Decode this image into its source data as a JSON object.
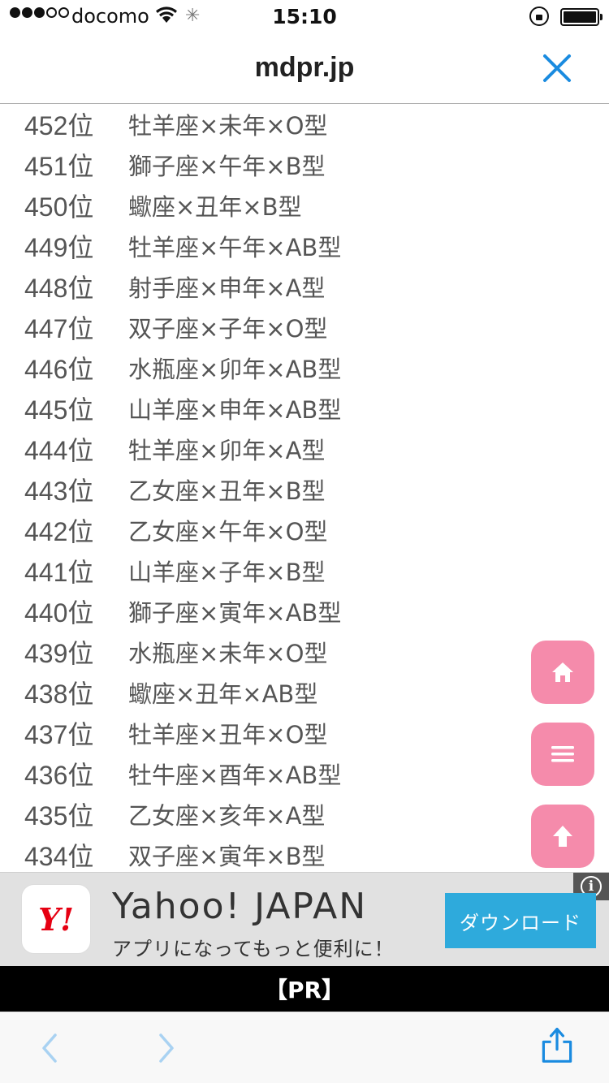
{
  "status_bar": {
    "carrier": "docomo",
    "time": "15:10"
  },
  "header": {
    "title": "mdpr.jp"
  },
  "ranking": [
    {
      "rank": "452位",
      "combo": "牡羊座×未年×O型"
    },
    {
      "rank": "451位",
      "combo": "獅子座×午年×B型"
    },
    {
      "rank": "450位",
      "combo": "蠍座×丑年×B型"
    },
    {
      "rank": "449位",
      "combo": "牡羊座×午年×AB型"
    },
    {
      "rank": "448位",
      "combo": "射手座×申年×A型"
    },
    {
      "rank": "447位",
      "combo": "双子座×子年×O型"
    },
    {
      "rank": "446位",
      "combo": "水瓶座×卯年×AB型"
    },
    {
      "rank": "445位",
      "combo": "山羊座×申年×AB型"
    },
    {
      "rank": "444位",
      "combo": "牡羊座×卯年×A型"
    },
    {
      "rank": "443位",
      "combo": "乙女座×丑年×B型"
    },
    {
      "rank": "442位",
      "combo": "乙女座×午年×O型"
    },
    {
      "rank": "441位",
      "combo": "山羊座×子年×B型"
    },
    {
      "rank": "440位",
      "combo": "獅子座×寅年×AB型"
    },
    {
      "rank": "439位",
      "combo": "水瓶座×未年×O型"
    },
    {
      "rank": "438位",
      "combo": "蠍座×丑年×AB型"
    },
    {
      "rank": "437位",
      "combo": "牡羊座×丑年×O型"
    },
    {
      "rank": "436位",
      "combo": "牡牛座×酉年×AB型"
    },
    {
      "rank": "435位",
      "combo": "乙女座×亥年×A型"
    },
    {
      "rank": "434位",
      "combo": "双子座×寅年×B型"
    }
  ],
  "floating_buttons": {
    "home_icon": "home-icon",
    "menu_icon": "menu-icon",
    "top_icon": "arrow-up-icon",
    "color": "#f58bab"
  },
  "ad": {
    "logo": "Y!",
    "title": "Yahoo! JAPAN",
    "subtitle": "アプリになってもっと便利に！",
    "button": "ダウンロード",
    "info": "i",
    "button_color": "#2eaadc"
  },
  "pr_bar": {
    "label": "【PR】"
  },
  "toolbar": {
    "accent": "#1a8be0"
  }
}
